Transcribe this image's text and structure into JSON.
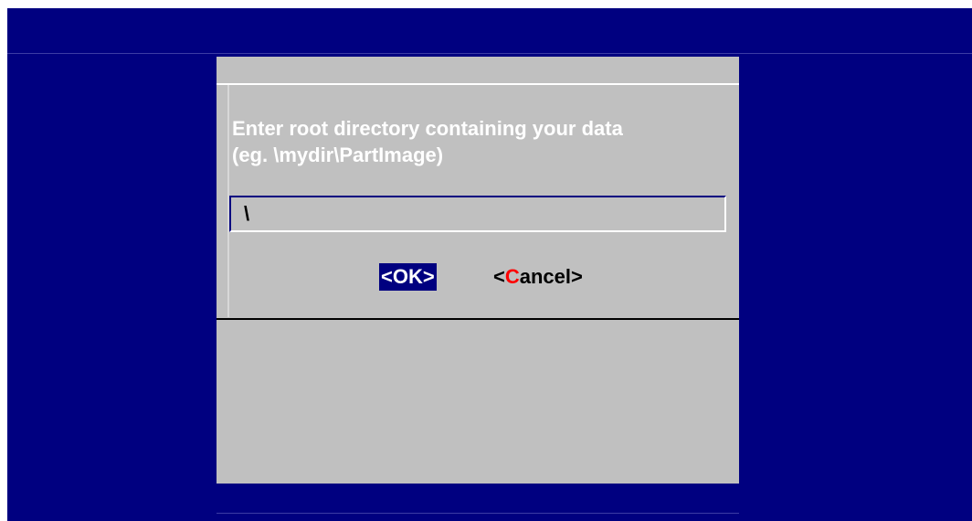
{
  "dialog": {
    "prompt_line1": "Enter root directory containing your data",
    "prompt_line2": "(eg. \\mydir\\PartImage)",
    "input_value": "\\",
    "ok_label": "<OK>",
    "cancel_open": "<",
    "cancel_hotkey": "C",
    "cancel_rest": "ancel>"
  },
  "colors": {
    "screen_background": "#000080",
    "dialog_background": "#c0c0c0",
    "focus_highlight": "#000080",
    "hotkey": "#ff0000"
  }
}
